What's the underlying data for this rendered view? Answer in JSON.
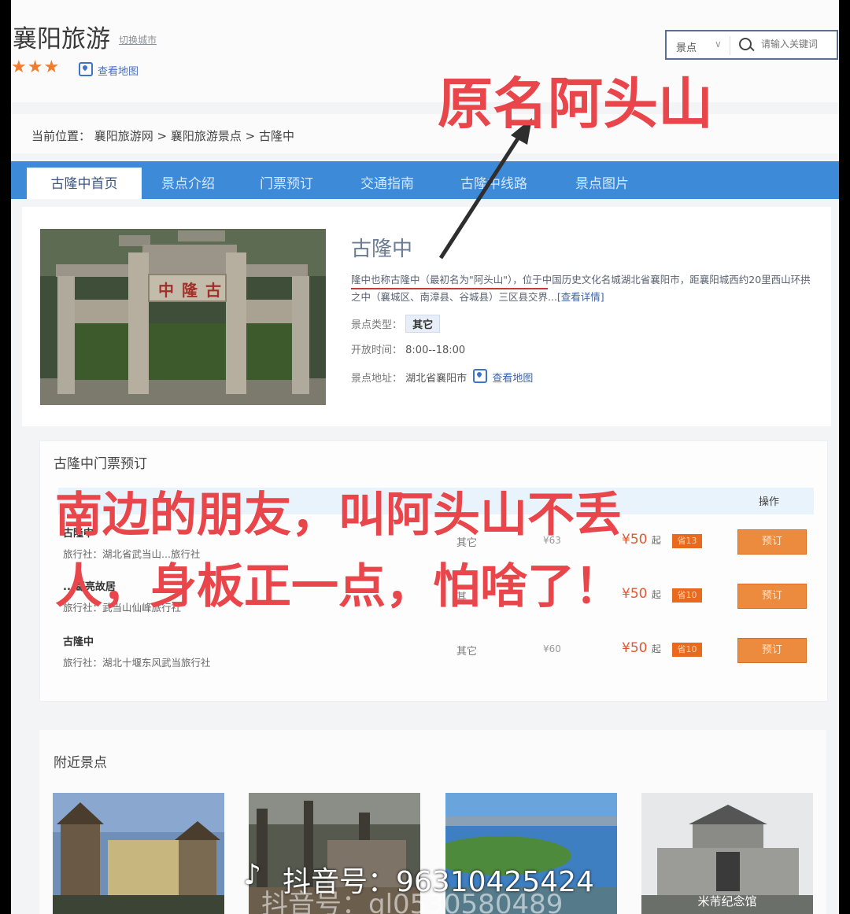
{
  "header": {
    "site_title": "襄阳旅游",
    "switch_city": "切换城市",
    "stars": "★★★",
    "view_map": "查看地图"
  },
  "search": {
    "category": "景点",
    "placeholder": "请输入关键词"
  },
  "breadcrumb": "当前位置：  襄阳旅游网 > 襄阳旅游景点 > 古隆中",
  "nav": {
    "tabs": [
      "古隆中首页",
      "景点介绍",
      "门票预订",
      "交通指南",
      "古隆中线路",
      "景点图片"
    ]
  },
  "spot": {
    "title": "古隆中",
    "description": "隆中也称古隆中（最初名为\"阿头山\"），位于中国历史文化名城湖北省襄阳市，距襄阳城西约20里西山环拱之中（襄城区、南漳县、谷城县）三区县交界...",
    "more_link": "[查看详情]",
    "type_label": "景点类型：",
    "type_value": "其它",
    "hours_label": "开放时间：",
    "hours_value": "8:00--18:00",
    "address_label": "景点地址：",
    "address_value": "湖北省襄阳市",
    "address_map": "查看地图",
    "sign_text": "中隆古"
  },
  "tickets": {
    "title": "古隆中门票预订",
    "header_op": "操作",
    "agency_label": "旅行社：",
    "rows": [
      {
        "name": "古隆中",
        "agency": "湖北省武当山...旅行社",
        "type": "其它",
        "orig": "¥63",
        "price": "¥50",
        "from": "起",
        "save": "省13",
        "book": "预订"
      },
      {
        "name": "...葛亮故居",
        "agency": "武当山仙峰旅行社",
        "type": "其",
        "orig": "",
        "price": "¥50",
        "from": "起",
        "save": "省10",
        "book": "预订"
      },
      {
        "name": "古隆中",
        "agency": "湖北十堰东风武当旅行社",
        "type": "其它",
        "orig": "¥60",
        "price": "¥50",
        "from": "起",
        "save": "省10",
        "book": "预订"
      }
    ]
  },
  "nearby": {
    "title": "附近景点",
    "items": [
      {
        "caption": ""
      },
      {
        "caption": ""
      },
      {
        "caption": ""
      },
      {
        "caption": "米芾纪念馆"
      }
    ]
  },
  "overlays": {
    "arrow_caption": "原名阿头山",
    "line1": "南边的朋友，叫阿头山不丢",
    "line2": "人，身板正一点，怕啥了！"
  },
  "watermark": {
    "primary": "抖音号：96310425424",
    "secondary": "抖音号：gl0530580489"
  },
  "colors": {
    "nav_blue": "#3d8ad9",
    "book_orange": "#ec8a3d",
    "price_red": "#e4572e",
    "overlay_red": "#e8464b"
  }
}
